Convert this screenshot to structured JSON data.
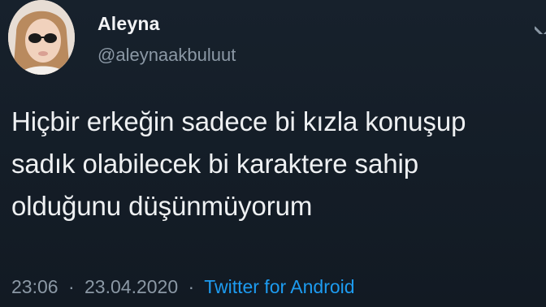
{
  "user": {
    "name": "Aleyna",
    "handle": "@aleynaakbuluut"
  },
  "tweet": {
    "lines": [
      "Hiçbir erkeğin sadece bi kızla konuşup",
      "sadık olabilecek bi karaktere sahip",
      "olduğunu düşünmüyorum"
    ],
    "time": "23:06",
    "separator": "·",
    "date": "23.04.2020",
    "source": "Twitter for Android"
  },
  "colors": {
    "background": "#15202b",
    "link": "#1d9bf0",
    "secondary_text": "#8b98a5"
  },
  "icons": {
    "avatar": "profile-photo",
    "more": "chevron-down-icon"
  }
}
